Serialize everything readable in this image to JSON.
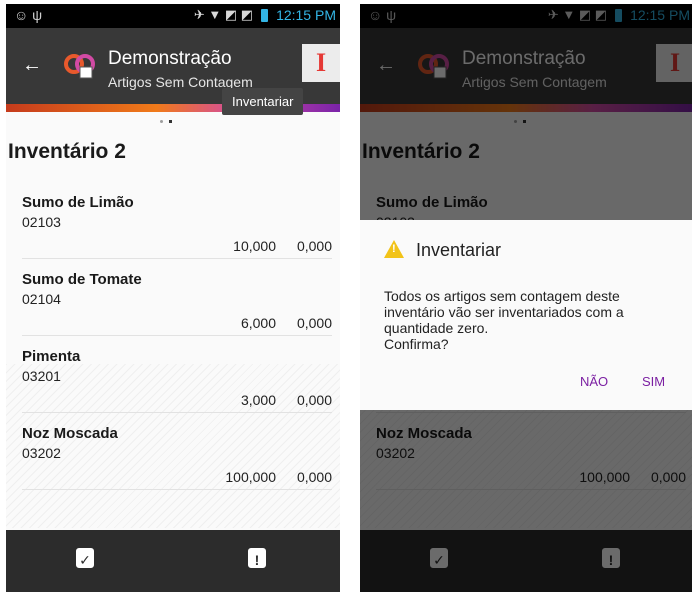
{
  "status": {
    "time": "12:15 PM"
  },
  "app": {
    "title": "Demonstração",
    "subtitle": "Artigos Sem Contagem"
  },
  "tooltip": "Inventariar",
  "inventory_title": "Inventário 2",
  "items": [
    {
      "name": "Sumo de Limão",
      "code": "02103",
      "qty": "10,000",
      "count": "0,000"
    },
    {
      "name": "Sumo de Tomate",
      "code": "02104",
      "qty": "6,000",
      "count": "0,000"
    },
    {
      "name": "Pimenta",
      "code": "03201",
      "qty": "3,000",
      "count": "0,000"
    },
    {
      "name": "Noz Moscada",
      "code": "03202",
      "qty": "100,000",
      "count": "0,000"
    }
  ],
  "dialog": {
    "title": "Inventariar",
    "message": "Todos os artigos sem contagem deste inventário vão ser inventariados com a quantidade zero.\nConfirma?",
    "no_label": "NÃO",
    "yes_label": "SIM"
  },
  "colors": {
    "accent": "#7b1fa2",
    "clock": "#33b5e5",
    "inventariar_icon": "#e53935",
    "warning": "#f2c318"
  },
  "icons": {
    "back": "arrow-left-icon",
    "inventariar": "letter-i-icon",
    "bottom_left": "clipboard-check-icon",
    "bottom_right": "clipboard-alert-icon"
  }
}
